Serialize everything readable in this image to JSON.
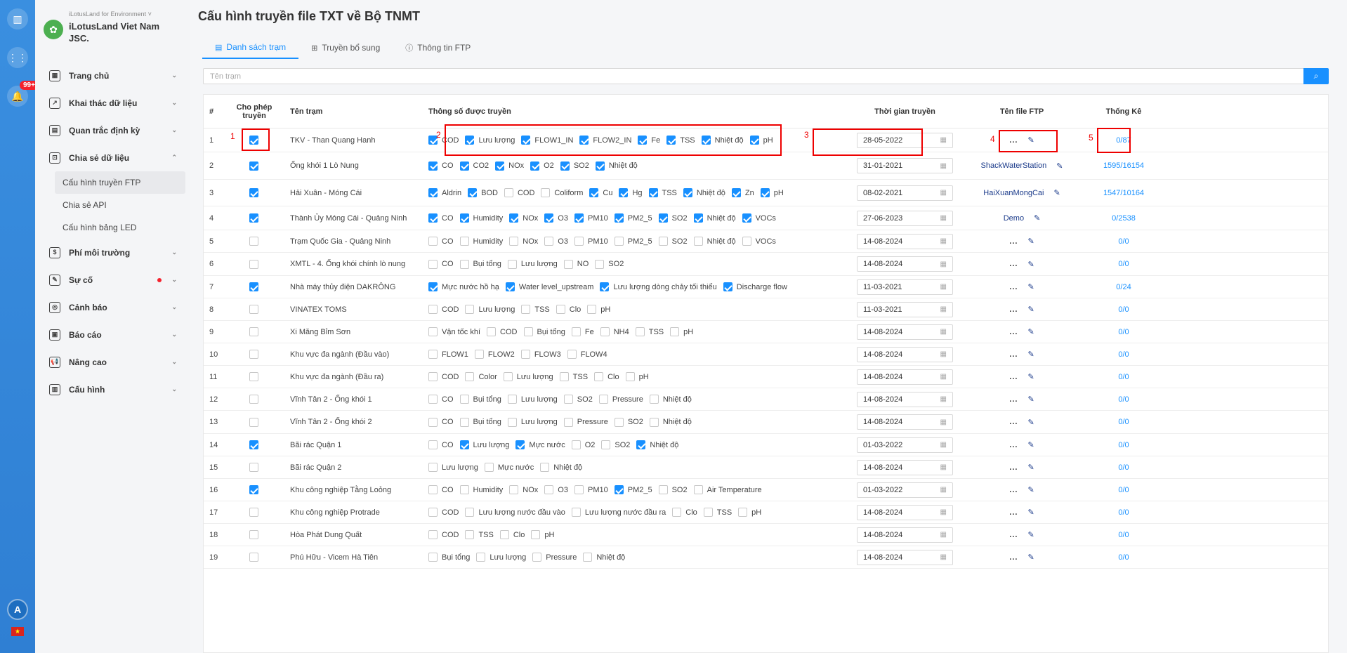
{
  "rail": {
    "badge": "99+",
    "avatar": "A",
    "flag": "★"
  },
  "sidebar": {
    "brand_tag": "iLotusLand for Environment ˅",
    "brand_name": "iLotusLand Viet Nam JSC.",
    "menu": [
      {
        "label": "Trang chủ"
      },
      {
        "label": "Khai thác dữ liệu"
      },
      {
        "label": "Quan trắc định kỳ"
      },
      {
        "label": "Chia sẻ dữ liệu"
      },
      {
        "label": "Phí môi trường"
      },
      {
        "label": "Sự cố"
      },
      {
        "label": "Cảnh báo"
      },
      {
        "label": "Báo cáo"
      },
      {
        "label": "Nâng cao"
      },
      {
        "label": "Cấu hình"
      }
    ],
    "submenu": [
      "Cấu hình truyền FTP",
      "Chia sẻ API",
      "Cấu hình bảng LED"
    ]
  },
  "page_title": "Cấu hình truyền file TXT về Bộ TNMT",
  "tabs": [
    "Danh sách trạm",
    "Truyền bổ sung",
    "Thông tin FTP"
  ],
  "search": {
    "placeholder": "Tên trạm"
  },
  "table": {
    "headers": {
      "num": "#",
      "allow": "Cho phép truyền",
      "name": "Tên trạm",
      "params": "Thông số được truyền",
      "date": "Thời gian truyền",
      "ftp": "Tên file FTP",
      "stat": "Thống Kê"
    },
    "rows": [
      {
        "num": "1",
        "allow": true,
        "name": "TKV - Than Quang Hanh",
        "params": [
          [
            "COD",
            true
          ],
          [
            "Lưu lượng",
            true
          ],
          [
            "FLOW1_IN",
            true
          ],
          [
            "FLOW2_IN",
            true
          ],
          [
            "Fe",
            true
          ],
          [
            "TSS",
            true
          ],
          [
            "Nhiệt độ",
            true
          ],
          [
            "pH",
            true
          ]
        ],
        "date": "28-05-2022",
        "ftp": "...",
        "stat": "0/87"
      },
      {
        "num": "2",
        "allow": true,
        "name": "Ống khói 1 Lò Nung",
        "params": [
          [
            "CO",
            true
          ],
          [
            "CO2",
            true
          ],
          [
            "NOx",
            true
          ],
          [
            "O2",
            true
          ],
          [
            "SO2",
            true
          ],
          [
            "Nhiệt độ",
            true
          ]
        ],
        "date": "31-01-2021",
        "ftp": "ShackWaterStation",
        "stat": "1595/16154"
      },
      {
        "num": "3",
        "allow": true,
        "name": "Hải Xuân - Móng Cái",
        "params": [
          [
            "Aldrin",
            true
          ],
          [
            "BOD",
            true
          ],
          [
            "COD",
            false
          ],
          [
            "Coliform",
            false
          ],
          [
            "Cu",
            true
          ],
          [
            "Hg",
            true
          ],
          [
            "TSS",
            true
          ],
          [
            "Nhiệt độ",
            true
          ],
          [
            "Zn",
            true
          ],
          [
            "pH",
            true
          ]
        ],
        "date": "08-02-2021",
        "ftp": "HaiXuanMongCai",
        "stat": "1547/10164"
      },
      {
        "num": "4",
        "allow": true,
        "name": "Thành Ủy Móng Cái - Quảng Ninh",
        "params": [
          [
            "CO",
            true
          ],
          [
            "Humidity",
            true
          ],
          [
            "NOx",
            true
          ],
          [
            "O3",
            true
          ],
          [
            "PM10",
            true
          ],
          [
            "PM2_5",
            true
          ],
          [
            "SO2",
            true
          ],
          [
            "Nhiệt độ",
            true
          ],
          [
            "VOCs",
            true
          ]
        ],
        "date": "27-06-2023",
        "ftp": "Demo",
        "stat": "0/2538"
      },
      {
        "num": "5",
        "allow": false,
        "name": "Trạm Quốc Gia - Quảng Ninh",
        "params": [
          [
            "CO",
            false
          ],
          [
            "Humidity",
            false
          ],
          [
            "NOx",
            false
          ],
          [
            "O3",
            false
          ],
          [
            "PM10",
            false
          ],
          [
            "PM2_5",
            false
          ],
          [
            "SO2",
            false
          ],
          [
            "Nhiệt độ",
            false
          ],
          [
            "VOCs",
            false
          ]
        ],
        "date": "14-08-2024",
        "ftp": "...",
        "stat": "0/0"
      },
      {
        "num": "6",
        "allow": false,
        "name": "XMTL - 4. Ống khói chính lò nung",
        "params": [
          [
            "CO",
            false
          ],
          [
            "Bụi tổng",
            false
          ],
          [
            "Lưu lượng",
            false
          ],
          [
            "NO",
            false
          ],
          [
            "SO2",
            false
          ]
        ],
        "date": "14-08-2024",
        "ftp": "...",
        "stat": "0/0"
      },
      {
        "num": "7",
        "allow": true,
        "name": "Nhà máy thủy điện DAKRÔNG",
        "params": [
          [
            "Mực nước hồ hạ",
            true
          ],
          [
            "Water level_upstream",
            true
          ],
          [
            "Lưu lượng dòng chảy tối thiểu",
            true
          ],
          [
            "Discharge flow",
            true
          ]
        ],
        "date": "11-03-2021",
        "ftp": "...",
        "stat": "0/24"
      },
      {
        "num": "8",
        "allow": false,
        "name": "VINATEX TOMS",
        "params": [
          [
            "COD",
            false
          ],
          [
            "Lưu lượng",
            false
          ],
          [
            "TSS",
            false
          ],
          [
            "Clo",
            false
          ],
          [
            "pH",
            false
          ]
        ],
        "date": "11-03-2021",
        "ftp": "...",
        "stat": "0/0"
      },
      {
        "num": "9",
        "allow": false,
        "name": "Xi Măng Bỉm Sơn",
        "params": [
          [
            "Vận tốc khí",
            false
          ],
          [
            "COD",
            false
          ],
          [
            "Bụi tổng",
            false
          ],
          [
            "Fe",
            false
          ],
          [
            "NH4",
            false
          ],
          [
            "TSS",
            false
          ],
          [
            "pH",
            false
          ]
        ],
        "date": "14-08-2024",
        "ftp": "...",
        "stat": "0/0"
      },
      {
        "num": "10",
        "allow": false,
        "name": "Khu vực đa ngành (Đầu vào)",
        "params": [
          [
            "FLOW1",
            false
          ],
          [
            "FLOW2",
            false
          ],
          [
            "FLOW3",
            false
          ],
          [
            "FLOW4",
            false
          ]
        ],
        "date": "14-08-2024",
        "ftp": "...",
        "stat": "0/0"
      },
      {
        "num": "11",
        "allow": false,
        "name": "Khu vực đa ngành (Đầu ra)",
        "params": [
          [
            "COD",
            false
          ],
          [
            "Color",
            false
          ],
          [
            "Lưu lượng",
            false
          ],
          [
            "TSS",
            false
          ],
          [
            "Clo",
            false
          ],
          [
            "pH",
            false
          ]
        ],
        "date": "14-08-2024",
        "ftp": "...",
        "stat": "0/0"
      },
      {
        "num": "12",
        "allow": false,
        "name": "Vĩnh Tân 2 - Ống khói 1",
        "params": [
          [
            "CO",
            false
          ],
          [
            "Bụi tổng",
            false
          ],
          [
            "Lưu lượng",
            false
          ],
          [
            "SO2",
            false
          ],
          [
            "Pressure",
            false
          ],
          [
            "Nhiệt độ",
            false
          ]
        ],
        "date": "14-08-2024",
        "ftp": "...",
        "stat": "0/0"
      },
      {
        "num": "13",
        "allow": false,
        "name": "Vĩnh Tân 2 - Ống khói 2",
        "params": [
          [
            "CO",
            false
          ],
          [
            "Bụi tổng",
            false
          ],
          [
            "Lưu lượng",
            false
          ],
          [
            "Pressure",
            false
          ],
          [
            "SO2",
            false
          ],
          [
            "Nhiệt độ",
            false
          ]
        ],
        "date": "14-08-2024",
        "ftp": "...",
        "stat": "0/0"
      },
      {
        "num": "14",
        "allow": true,
        "name": "Bãi rác Quận 1",
        "params": [
          [
            "CO",
            false
          ],
          [
            "Lưu lượng",
            true
          ],
          [
            "Mực nước",
            true
          ],
          [
            "O2",
            false
          ],
          [
            "SO2",
            false
          ],
          [
            "Nhiệt độ",
            true
          ]
        ],
        "date": "01-03-2022",
        "ftp": "...",
        "stat": "0/0"
      },
      {
        "num": "15",
        "allow": false,
        "name": "Bãi rác Quận 2",
        "params": [
          [
            "Lưu lượng",
            false
          ],
          [
            "Mực nước",
            false
          ],
          [
            "Nhiệt độ",
            false
          ]
        ],
        "date": "14-08-2024",
        "ftp": "...",
        "stat": "0/0"
      },
      {
        "num": "16",
        "allow": true,
        "name": "Khu công nghiệp Tằng Loỏng",
        "params": [
          [
            "CO",
            false
          ],
          [
            "Humidity",
            false
          ],
          [
            "NOx",
            false
          ],
          [
            "O3",
            false
          ],
          [
            "PM10",
            false
          ],
          [
            "PM2_5",
            true
          ],
          [
            "SO2",
            false
          ],
          [
            "Air Temperature",
            false
          ]
        ],
        "date": "01-03-2022",
        "ftp": "...",
        "stat": "0/0"
      },
      {
        "num": "17",
        "allow": false,
        "name": "Khu công nghiệp Protrade",
        "params": [
          [
            "COD",
            false
          ],
          [
            "Lưu lượng nước đầu vào",
            false
          ],
          [
            "Lưu lượng nước đầu ra",
            false
          ],
          [
            "Clo",
            false
          ],
          [
            "TSS",
            false
          ],
          [
            "pH",
            false
          ]
        ],
        "date": "14-08-2024",
        "ftp": "...",
        "stat": "0/0"
      },
      {
        "num": "18",
        "allow": false,
        "name": "Hòa Phát Dung Quất",
        "params": [
          [
            "COD",
            false
          ],
          [
            "TSS",
            false
          ],
          [
            "Clo",
            false
          ],
          [
            "pH",
            false
          ]
        ],
        "date": "14-08-2024",
        "ftp": "...",
        "stat": "0/0"
      },
      {
        "num": "19",
        "allow": false,
        "name": "Phú Hữu - Vicem Hà Tiên",
        "params": [
          [
            "Bụi tổng",
            false
          ],
          [
            "Lưu lượng",
            false
          ],
          [
            "Pressure",
            false
          ],
          [
            "Nhiệt độ",
            false
          ]
        ],
        "date": "14-08-2024",
        "ftp": "...",
        "stat": "0/0"
      }
    ]
  },
  "annotations": [
    "1",
    "2",
    "3",
    "4",
    "5"
  ],
  "colors": {
    "accent": "#1890ff",
    "annotation": "#e00000",
    "rail": "#2f7fd3"
  }
}
